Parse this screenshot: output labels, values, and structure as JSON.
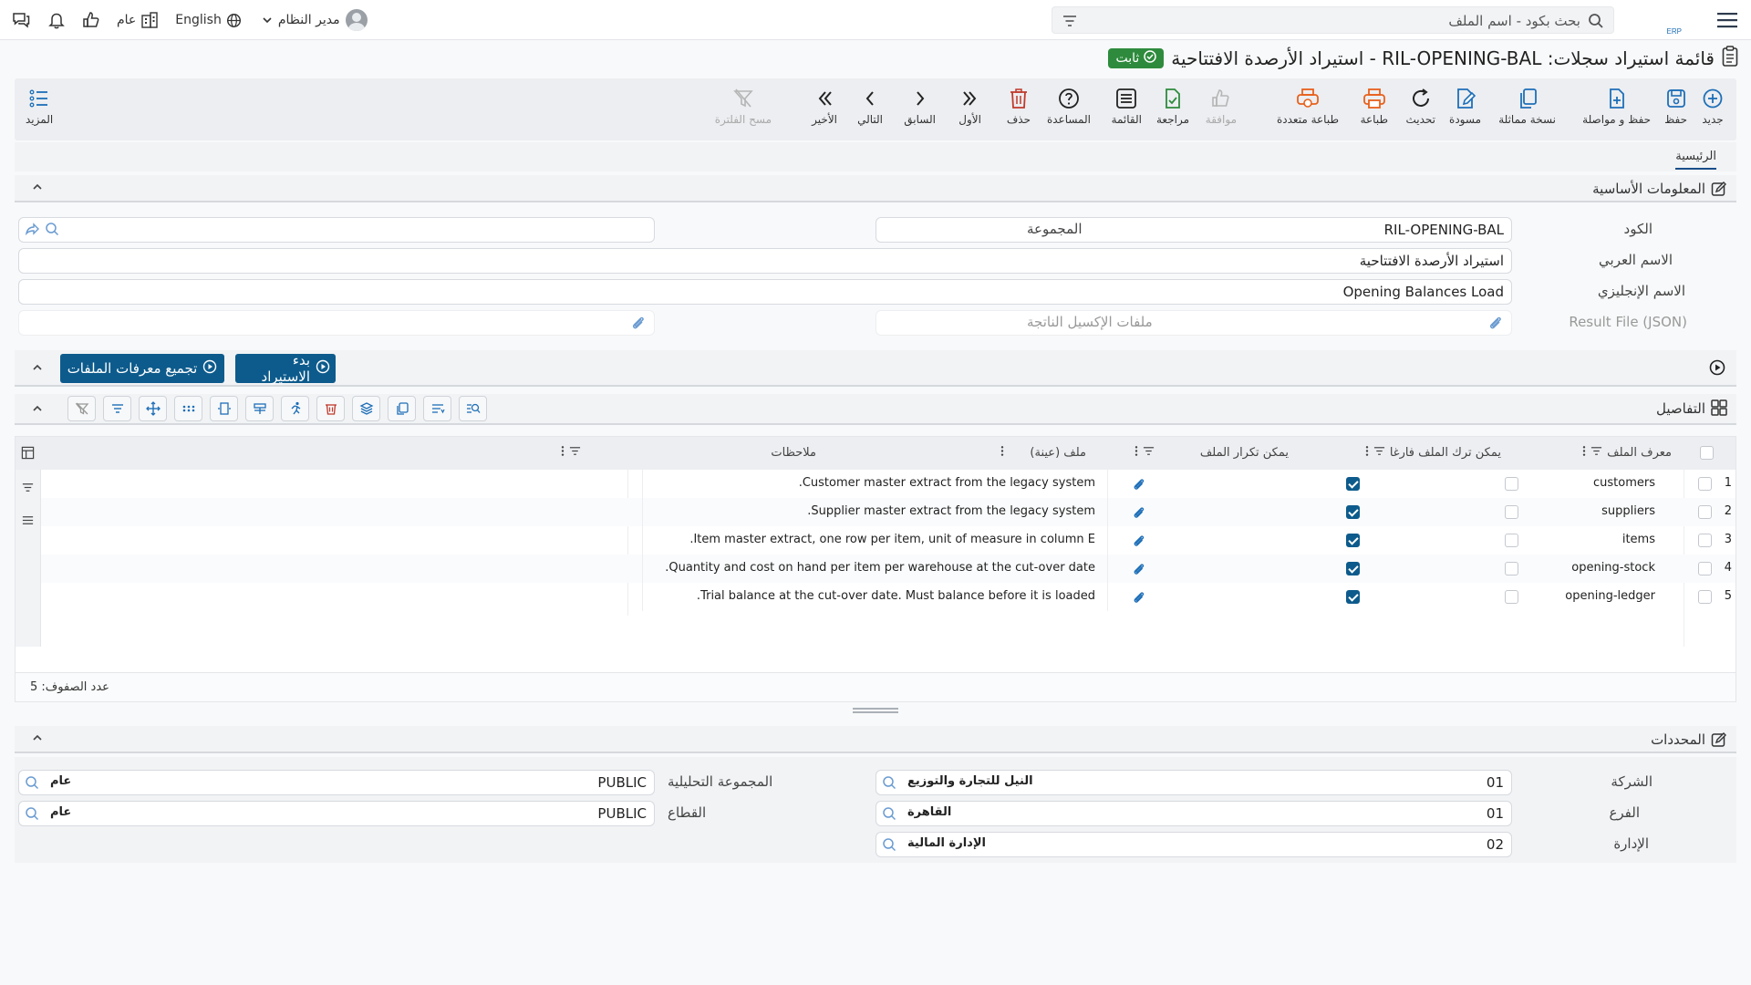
{
  "topbar": {
    "search_placeholder": "بحث بكود - اسم الملف",
    "user_name": "مدير النظام",
    "language": "English",
    "scope": "عام"
  },
  "title": {
    "text": "قائمة استيراد سجلات: RIL-OPENING-BAL - استيراد الأرصدة الافتتاحية",
    "badge": "ثابت"
  },
  "toolbar": {
    "items": [
      {
        "label": "جديد",
        "icon": "plus-circle-icon"
      },
      {
        "label": "حفظ",
        "icon": "save-icon"
      },
      {
        "label": "حفظ و مواصلة",
        "icon": "file-plus-icon"
      },
      {
        "label": "نسخة مماثلة",
        "icon": "copy-icon"
      },
      {
        "label": "مسودة",
        "icon": "draft-icon"
      },
      {
        "label": "تحديث",
        "icon": "refresh-icon"
      },
      {
        "label": "طباعة",
        "icon": "print-icon"
      },
      {
        "label": "طباعة متعددة",
        "icon": "multi-print-icon"
      },
      {
        "label": "موافقة",
        "icon": "thumbs-up-icon"
      },
      {
        "label": "مراجعة",
        "icon": "review-icon"
      },
      {
        "label": "القائمة",
        "icon": "list-icon"
      },
      {
        "label": "المساعدة",
        "icon": "help-icon"
      },
      {
        "label": "حذف",
        "icon": "trash-icon"
      },
      {
        "label": "الأول",
        "icon": "first-icon"
      },
      {
        "label": "السابق",
        "icon": "prev-icon"
      },
      {
        "label": "التالي",
        "icon": "next-icon"
      },
      {
        "label": "الأخير",
        "icon": "last-icon"
      },
      {
        "label": "مسح الفلترة",
        "icon": "clear-filter-icon"
      }
    ],
    "more_label": "المزيد"
  },
  "tabs": {
    "home": "الرئيسية"
  },
  "basic_info": {
    "title": "المعلومات الأساسية",
    "code_label": "الكود",
    "code_value": "RIL-OPENING-BAL",
    "group_label": "المجموعة",
    "group_value": "",
    "arabic_name_label": "الاسم العربي",
    "arabic_name_value": "استيراد الأرصدة الافتتاحية",
    "english_name_label": "الاسم الإنجليزي",
    "english_name_value": "Opening Balances Load",
    "result_file_label": "Result File (JSON)",
    "excel_files_label": "ملفات الإكسيل الناتجة"
  },
  "actions": {
    "start_import": "بدء الاستيراد",
    "collect_ids": "تجميع معرفات الملفات"
  },
  "details": {
    "title": "التفاصيل",
    "columns": {
      "file_id": "معرف الملف",
      "can_be_empty": "يمكن ترك الملف فارغا",
      "can_repeat": "يمكن تكرار الملف",
      "sample_file": "ملف (عينة)",
      "notes": "ملاحظات"
    },
    "rows": [
      {
        "num": "1",
        "file_id": "customers",
        "can_be_empty": false,
        "can_repeat": true,
        "notes": "Customer master extract from the legacy system."
      },
      {
        "num": "2",
        "file_id": "suppliers",
        "can_be_empty": false,
        "can_repeat": true,
        "notes": "Supplier master extract from the legacy system."
      },
      {
        "num": "3",
        "file_id": "items",
        "can_be_empty": false,
        "can_repeat": true,
        "notes": "Item master extract, one row per item, unit of measure in column E."
      },
      {
        "num": "4",
        "file_id": "opening-stock",
        "can_be_empty": false,
        "can_repeat": true,
        "notes": "Quantity and cost on hand per item per warehouse at the cut-over date."
      },
      {
        "num": "5",
        "file_id": "opening-ledger",
        "can_be_empty": false,
        "can_repeat": true,
        "notes": "Trial balance at the cut-over date. Must balance before it is loaded."
      }
    ],
    "row_count_label": "عدد الصفوف: 5"
  },
  "determinants": {
    "title": "المحددات",
    "company_label": "الشركة",
    "company_code": "01",
    "company_name": "النيل للتجارة والتوزيع",
    "branch_label": "الفرع",
    "branch_code": "01",
    "branch_name": "القاهرة",
    "department_label": "الإدارة",
    "department_code": "02",
    "department_name": "الإدارة المالية",
    "analytic_group_label": "المجموعة التحليلية",
    "analytic_group_code": "PUBLIC",
    "analytic_group_name": "عام",
    "sector_label": "القطاع",
    "sector_code": "PUBLIC",
    "sector_name": "عام"
  },
  "colors": {
    "accent": "#0d5b8c",
    "badge": "#2e8b3d",
    "danger": "#c0392b",
    "orange": "#e8601c",
    "green": "#2e8b3d",
    "blue_icon": "#1e6fb8"
  }
}
